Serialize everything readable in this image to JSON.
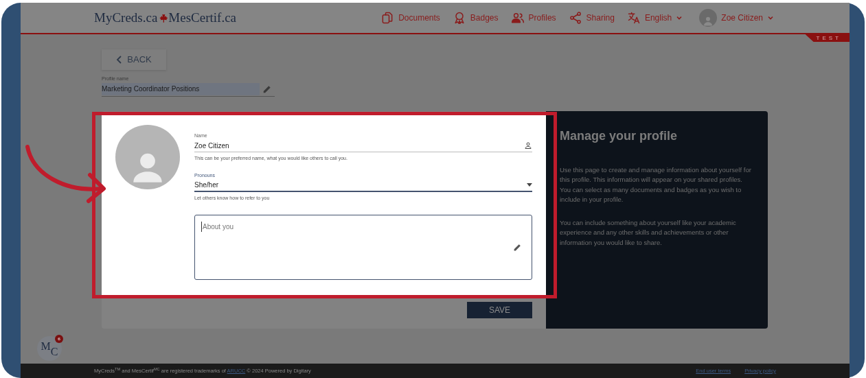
{
  "header": {
    "logo": [
      "MyCreds.ca",
      "MesCertif.ca"
    ],
    "nav": [
      {
        "kind": "documents",
        "label": "Documents"
      },
      {
        "kind": "badges",
        "label": "Badges"
      },
      {
        "kind": "profiles",
        "label": "Profiles"
      },
      {
        "kind": "sharing",
        "label": "Sharing"
      },
      {
        "kind": "language",
        "label": "English"
      },
      {
        "kind": "user",
        "label": "Zoe Citizen"
      }
    ],
    "env_tag": "TEST"
  },
  "back_button": "BACK",
  "profile_name": {
    "label": "Profile name",
    "value": "Marketing Coordinator Positions"
  },
  "form": {
    "name": {
      "label": "Name",
      "value": "Zoe Citizen",
      "helper": "This can be your preferred name, what you would like others to call you."
    },
    "pronouns": {
      "label": "Pronouns",
      "value": "She/her",
      "helper": "Let others know how to refer to you"
    },
    "about": {
      "placeholder": "About you"
    },
    "save": "SAVE"
  },
  "info_panel": {
    "title": "Manage your profile",
    "paragraphs": [
      "Use this page to create and manage information about yourself for this profile. This information will appear on your shared profiles. You can select as many documents and badges as you wish to include in your profile.",
      "You can include something about yourself like your academic experience and any other skills and achievements or other information you would like to share."
    ]
  },
  "chat_logo": {
    "letters": [
      "M",
      "C"
    ],
    "count": "6"
  },
  "footer": {
    "before_link": "MyCreds$^{TM}$ and MesCertif$^{MC}$ are registered trademarks of ",
    "link": "ARUCC",
    "after_link": " © 2024 Powered by Digitary",
    "links": [
      "End user terms",
      "Privacy policy"
    ]
  }
}
